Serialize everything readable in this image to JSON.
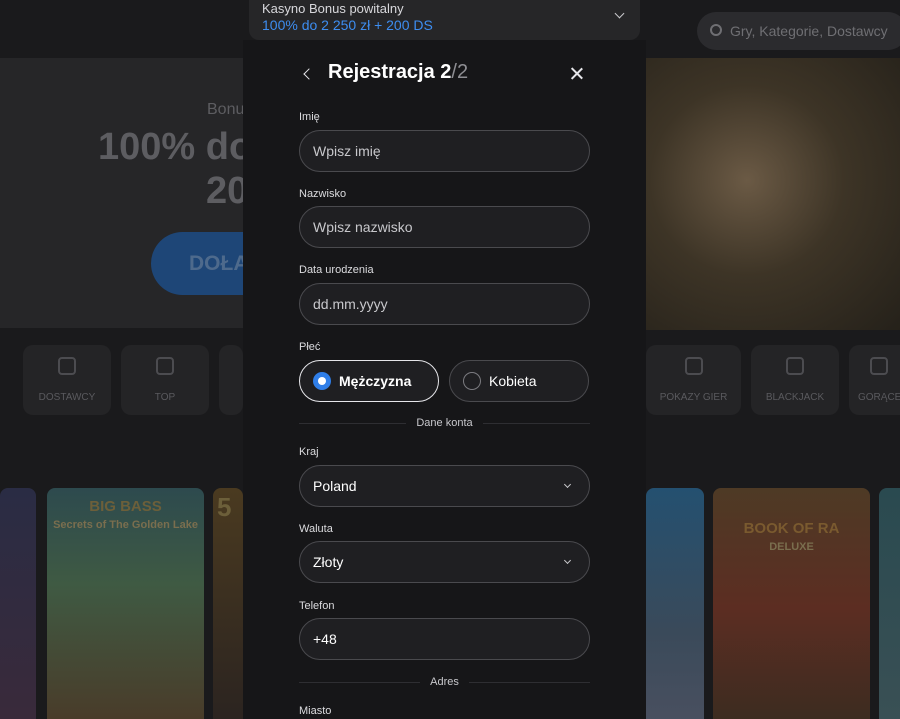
{
  "background": {
    "search_placeholder": "Gry, Kategorie, Dostawcy",
    "hero_subtitle": "Bonu",
    "hero_title_line1": "100% do",
    "hero_title_line2": "20",
    "cta_label": "DOŁĄ",
    "categories": [
      "DOSTAWCY",
      "TOP",
      "POKAZY GIER",
      "BLACKJACK",
      "GORĄCE"
    ],
    "games": [
      {
        "title": "BIG BASS",
        "subtitle": "Secrets of The Golden Lake"
      },
      {
        "title": "5",
        "subtitle": ""
      },
      {
        "title": "BOOK OF RA",
        "subtitle": "DELUXE"
      }
    ]
  },
  "bonus_selector": {
    "label": "Kasyno Bonus powitalny",
    "value": "100% do 2 250 zł + 200 DS",
    "accent_color": "#3d8df0"
  },
  "modal": {
    "title": "Rejestracja 2",
    "step_total": "/2",
    "fields": {
      "first_name": {
        "label": "Imię",
        "placeholder": "Wpisz imię"
      },
      "last_name": {
        "label": "Nazwisko",
        "placeholder": "Wpisz nazwisko"
      },
      "birth_date": {
        "label": "Data urodzenia",
        "placeholder": "dd.mm.yyyy"
      },
      "gender": {
        "label": "Płeć",
        "options": [
          "Mężczyzna",
          "Kobieta"
        ],
        "selected": "Mężczyzna"
      },
      "country": {
        "label": "Kraj",
        "value": "Poland"
      },
      "currency": {
        "label": "Waluta",
        "value": "Złoty"
      },
      "phone": {
        "label": "Telefon",
        "value": "+48"
      },
      "city": {
        "label": "Miasto"
      }
    },
    "section_account": "Dane konta",
    "section_address": "Adres"
  }
}
